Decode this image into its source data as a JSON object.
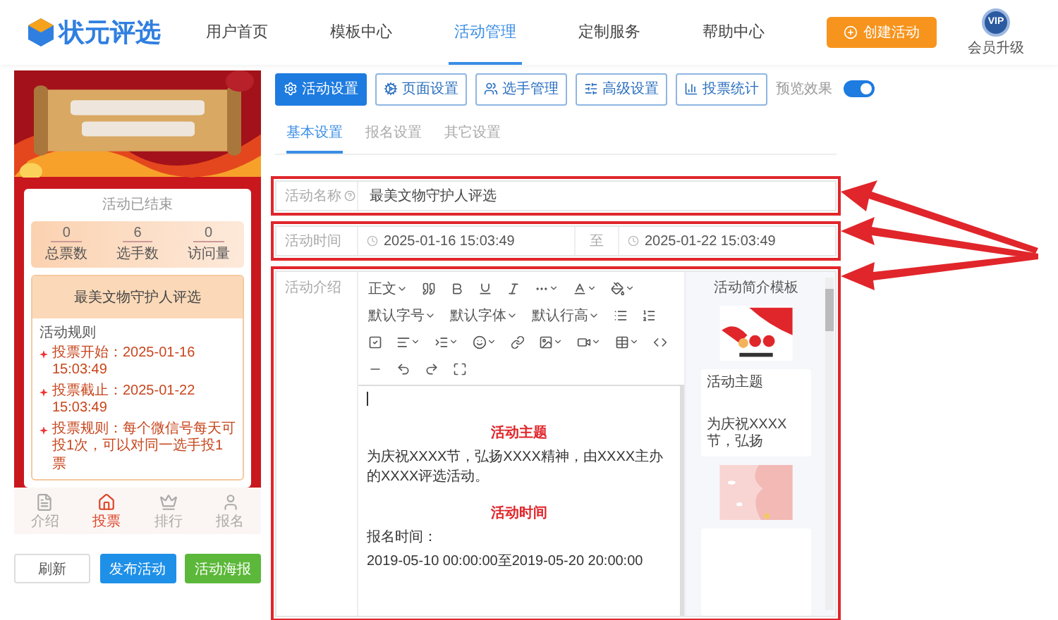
{
  "header": {
    "logo": "状元评选",
    "nav": [
      {
        "label": "用户首页",
        "selected": false
      },
      {
        "label": "模板中心",
        "selected": false
      },
      {
        "label": "活动管理",
        "selected": true
      },
      {
        "label": "定制服务",
        "selected": false
      },
      {
        "label": "帮助中心",
        "selected": false
      }
    ],
    "create_button": "创建活动",
    "vip_badge": "VIP",
    "vip_label": "会员升级"
  },
  "preview": {
    "status": "活动已结束",
    "stats": [
      {
        "value": "0",
        "label": "总票数"
      },
      {
        "value": "6",
        "label": "选手数"
      },
      {
        "value": "0",
        "label": "访问量"
      }
    ],
    "title": "最美文物守护人评选",
    "rules_heading": "活动规则",
    "rules": [
      "投票开始：2025-01-16 15:03:49",
      "投票截止：2025-01-22 15:03:49",
      "投票规则：每个微信号每天可投1次，可以对同一选手投1票"
    ],
    "tabbar": [
      {
        "label": "介绍",
        "selected": false
      },
      {
        "label": "投票",
        "selected": true
      },
      {
        "label": "排行",
        "selected": false
      },
      {
        "label": "报名",
        "selected": false
      }
    ],
    "actions": [
      {
        "label": "刷新",
        "kind": "outline"
      },
      {
        "label": "发布活动",
        "kind": "primary"
      },
      {
        "label": "活动海报",
        "kind": "success"
      }
    ]
  },
  "settings": {
    "tools": [
      {
        "label": "活动设置",
        "selected": true
      },
      {
        "label": "页面设置",
        "selected": false
      },
      {
        "label": "选手管理",
        "selected": false
      },
      {
        "label": "高级设置",
        "selected": false
      },
      {
        "label": "投票统计",
        "selected": false
      }
    ],
    "preview_toggle": {
      "label": "预览效果",
      "on": true
    },
    "subtabs": [
      {
        "label": "基本设置",
        "selected": true
      },
      {
        "label": "报名设置",
        "selected": false
      },
      {
        "label": "其它设置",
        "selected": false
      }
    ],
    "name_field": {
      "label": "活动名称",
      "value": "最美文物守护人评选"
    },
    "time_field": {
      "label": "活动时间",
      "start": "2025-01-16 15:03:49",
      "separator": "至",
      "end": "2025-01-22 15:03:49"
    },
    "intro": {
      "label": "活动介绍",
      "dropdowns": [
        "正文",
        "默认字号",
        "默认字体",
        "默认行高"
      ],
      "content": [
        {
          "kind": "heading",
          "text": "活动主题"
        },
        {
          "kind": "text",
          "text": "为庆祝XXXX节，弘扬XXXX精神，由XXXX主办的XXXX评选活动。"
        },
        {
          "kind": "heading",
          "text": "活动时间"
        },
        {
          "kind": "text",
          "text": "报名时间："
        },
        {
          "kind": "text",
          "text": "2019-05-10 00:00:00至2019-05-20 20:00:00"
        }
      ],
      "templates": {
        "title": "活动简介模板",
        "cards": [
          {
            "kind": "picture"
          },
          {
            "kind": "text",
            "title": "活动主题",
            "text": "为庆祝XXXX节，弘扬"
          },
          {
            "kind": "picture"
          },
          {
            "kind": "blank"
          }
        ]
      }
    }
  }
}
